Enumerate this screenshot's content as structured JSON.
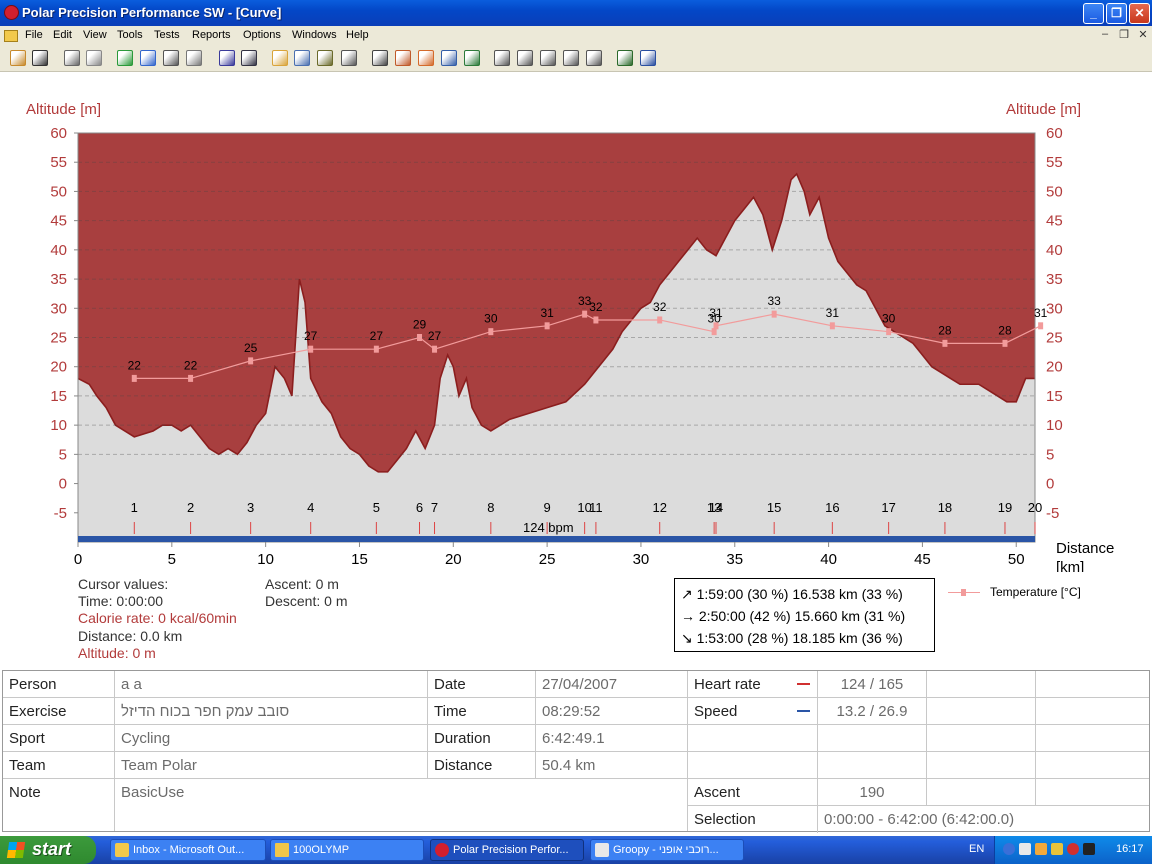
{
  "window": {
    "title": "Polar Precision Performance SW - [Curve]",
    "buttons": [
      "_",
      "❐",
      "✕"
    ]
  },
  "menu": {
    "items": [
      "File",
      "Edit",
      "View",
      "Tools",
      "Tests",
      "Reports",
      "Options",
      "Windows",
      "Help"
    ],
    "mdi_controls": [
      "–",
      "❐",
      "✕"
    ]
  },
  "toolbar": {
    "icons": [
      "open-icon",
      "save-icon",
      "print-icon",
      "copy-icon",
      "refresh-icon",
      "globe-icon",
      "sound-icon",
      "tool-icon",
      "calendar-icon",
      "book-icon",
      "curve-icon",
      "bar-icon",
      "percent-icon",
      "grid-icon",
      "zoom-icon",
      "chart-icon",
      "compare-icon",
      "swap-icon",
      "graph-icon",
      "report1-icon",
      "report2-icon",
      "report3-icon",
      "report4-icon",
      "report5-icon",
      "export-icon",
      "person-icon"
    ]
  },
  "chart_data": {
    "type": "area",
    "title": "",
    "ylabel_left": "Altitude [m]",
    "ylabel_right": "Altitude [m]",
    "xlabel": [
      "Distance",
      "[km]"
    ],
    "x_ticks": [
      "0",
      "5",
      "10",
      "15",
      "20",
      "25",
      "30",
      "35",
      "40",
      "45",
      "50"
    ],
    "y_ticks": [
      "60",
      "55",
      "50",
      "45",
      "40",
      "35",
      "30",
      "25",
      "20",
      "15",
      "10",
      "5",
      "0",
      "-5"
    ],
    "xlim": [
      0,
      51
    ],
    "ylim": [
      -10,
      60
    ],
    "altitude": {
      "x": [
        0,
        0.6,
        1,
        1.5,
        2,
        3,
        4,
        4.5,
        5,
        5.5,
        6,
        6.5,
        7,
        7.5,
        8,
        8.5,
        9,
        9.5,
        10,
        10.5,
        11,
        11.4,
        11.8,
        12.1,
        12.4,
        13,
        13.5,
        14,
        14.5,
        15,
        15.5,
        16,
        16.5,
        17,
        17.5,
        18,
        18.5,
        19,
        19.3,
        19.7,
        20,
        20.3,
        20.7,
        21,
        21.5,
        22,
        22.5,
        23,
        24,
        25,
        26,
        27,
        27.5,
        28,
        28.5,
        29,
        29.5,
        30,
        30.5,
        31,
        31.5,
        32,
        32.5,
        33,
        33.5,
        34,
        34.5,
        35,
        35.5,
        36,
        36.5,
        37,
        37.5,
        38,
        38.3,
        38.7,
        39,
        39.5,
        40,
        40.5,
        41,
        41.5,
        42,
        42.5,
        43,
        43.5,
        44,
        44.5,
        45,
        45.5,
        46,
        46.5,
        47,
        47.5,
        48,
        48.5,
        49,
        49.5,
        50,
        50.5,
        51
      ],
      "y": [
        18,
        17,
        15,
        13,
        10,
        8,
        9,
        10,
        10,
        9,
        10,
        8,
        6,
        5,
        6,
        5,
        7,
        10,
        12,
        20,
        18,
        15,
        35,
        31,
        18,
        14,
        12,
        8,
        6,
        5,
        3,
        2,
        2,
        4,
        6,
        9,
        6,
        10,
        18,
        22,
        20,
        15,
        18,
        13,
        10,
        9,
        10,
        11,
        12,
        13,
        14,
        17,
        19,
        21,
        23,
        26,
        28,
        30,
        31,
        34,
        36,
        38,
        40,
        42,
        40,
        39,
        42,
        45,
        47,
        49,
        46,
        40,
        45,
        52,
        53,
        50,
        46,
        49,
        42,
        38,
        36,
        34,
        33,
        30,
        27,
        26,
        25,
        24,
        22,
        20,
        19,
        18,
        17,
        17,
        17,
        16,
        15,
        14,
        14,
        18,
        18
      ]
    },
    "heart_rate_label": "124 bpm",
    "laps": [
      "1",
      "2",
      "3",
      "4",
      "5",
      "6",
      "7",
      "8",
      "9",
      "10",
      "11",
      "12",
      "13",
      "14",
      "15",
      "16",
      "17",
      "18",
      "19",
      "20"
    ],
    "lap_x": [
      3,
      6,
      9.2,
      12.4,
      15.9,
      18.2,
      19,
      22,
      25,
      27,
      27.6,
      31,
      33.9,
      34,
      37.1,
      40.2,
      43.2,
      46.2,
      49.4,
      51
    ],
    "temperature": {
      "name": "Temperature [°C]",
      "x": [
        3,
        6,
        9.2,
        12.4,
        15.9,
        18.2,
        19,
        22,
        25,
        27,
        27.6,
        31,
        33.9,
        34,
        37.1,
        40.2,
        43.2,
        46.2,
        49.4,
        51.3
      ],
      "values": [
        22,
        22,
        25,
        27,
        27,
        29,
        27,
        30,
        31,
        33,
        32,
        32,
        30,
        31,
        33,
        31,
        30,
        28,
        28,
        31
      ]
    },
    "colors": {
      "background_fill": "#a83f3f",
      "terrain_fill": "#dcdcdc",
      "altitude_line": "#8b1e1e",
      "temperature_line": "#f29b9b",
      "speed_bar": "#2a55a6"
    }
  },
  "cursor": {
    "header": "Cursor values:",
    "time": "Time: 0:00:00",
    "calorie": "Calorie rate: 0 kcal/60min",
    "distance": "Distance: 0.0 km",
    "altitude": "Altitude: 0 m",
    "ascent": "Ascent: 0 m",
    "descent": "Descent: 0 m"
  },
  "summary": {
    "rows": [
      "↗ 1:59:00  (30 %) 16.538 km  (33 %)",
      "→ 2:50:00  (42 %) 15.660 km  (31 %)",
      "↘ 1:53:00  (28 %) 18.185 km  (36 %)"
    ]
  },
  "info": {
    "person_label": "Person",
    "person": "a a",
    "exercise_label": "Exercise",
    "exercise": "סובב עמק חפר בכוח הדיזל",
    "sport_label": "Sport",
    "sport": "Cycling",
    "team_label": "Team",
    "team": "Team Polar",
    "note_label": "Note",
    "note": "BasicUse",
    "date_label": "Date",
    "date": "27/04/2007",
    "time_label": "Time",
    "time": "08:29:52",
    "duration_label": "Duration",
    "duration": "6:42:49.1",
    "distance_label": "Distance",
    "distance": "50.4 km",
    "hr_label": "Heart rate",
    "hr": "124 / 165",
    "hr_color": "#d03030",
    "speed_label": "Speed",
    "speed": "13.2 / 26.9",
    "speed_color": "#2a55a6",
    "ascent_label": "Ascent",
    "ascent": "190",
    "selection_label": "Selection",
    "selection": "0:00:00 - 6:42:00 (6:42:00.0)"
  },
  "taskbar": {
    "start": "start",
    "tasks": [
      "Inbox - Microsoft Out...",
      "100OLYMP",
      "Polar Precision Perfor...",
      "Groopy - רוכבי אופני..."
    ],
    "lang": "EN",
    "clock": "16:17"
  }
}
